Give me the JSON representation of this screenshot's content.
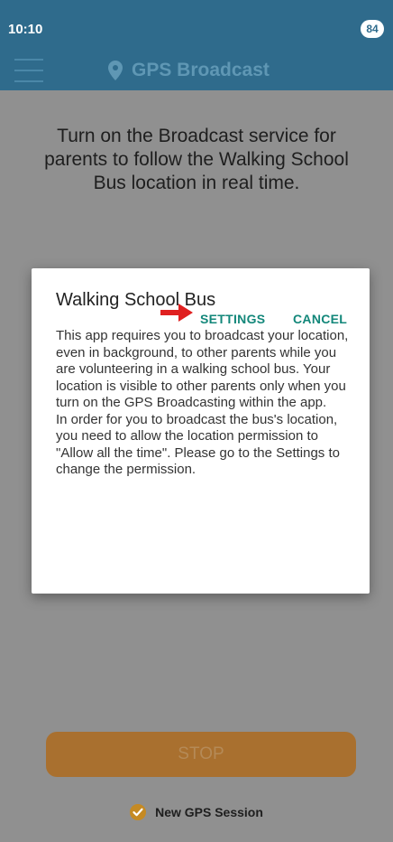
{
  "status_bar": {
    "time": "10:10",
    "battery": "84"
  },
  "app_bar": {
    "title": "GPS Broadcast"
  },
  "main": {
    "intro_text": "Turn on the Broadcast service for parents to follow the Walking School Bus location in real time.",
    "stop_label": "STOP",
    "session_label": "New GPS Session"
  },
  "dialog": {
    "title": "Walking School Bus",
    "body_paragraphs": [
      "This app requires you to broadcast your location, even in background, to other parents while you are volunteering in a walking school bus. Your location is visible to other parents only when you turn on the GPS Broadcasting within the app.",
      "In order for you to broadcast the bus's location, you need to allow the location permission to \"Allow all the time\". Please go to the Settings to change the permission."
    ],
    "settings_label": "SETTINGS",
    "cancel_label": "CANCEL"
  },
  "colors": {
    "app_bar": "#2f6b8c",
    "accent": "#13877a",
    "stop_button": "#a9702f",
    "check": "#e0a020",
    "arrow": "#e02020"
  },
  "icons": {
    "menu": "hamburger-menu-icon",
    "title": "map-pin-icon",
    "session": "check-circle-icon",
    "pointer": "red-arrow-icon"
  }
}
